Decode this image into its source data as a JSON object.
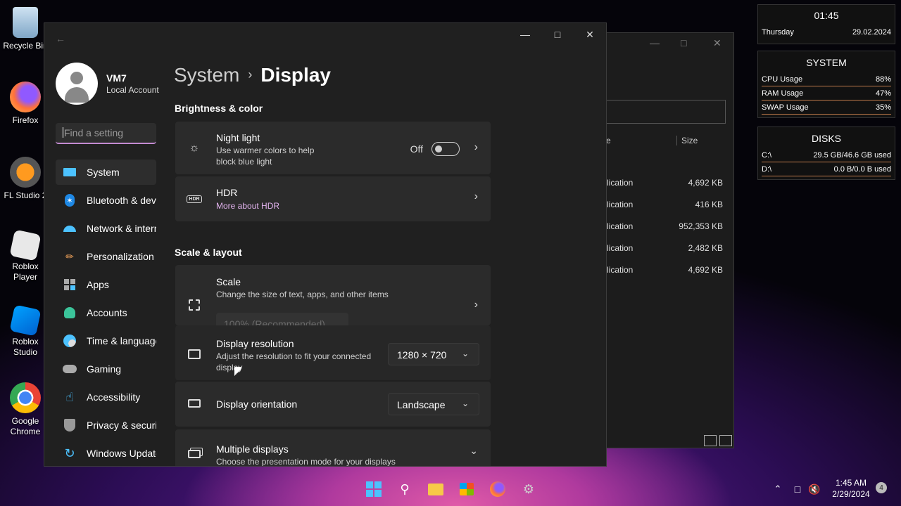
{
  "desktop": {
    "icons": [
      {
        "label": "Recycle Bin",
        "icon": "recycle-bin-icon"
      },
      {
        "label": "Firefox",
        "icon": "firefox-icon"
      },
      {
        "label": "FL Studio 2",
        "icon": "fl-studio-icon"
      },
      {
        "label": "Roblox Player",
        "icon": "roblox-player-icon"
      },
      {
        "label": "Roblox Studio",
        "icon": "roblox-studio-icon"
      },
      {
        "label": "Google Chrome",
        "icon": "chrome-icon"
      }
    ]
  },
  "explorer_bg": {
    "column_size": "Size",
    "column_type_fragment": "e",
    "rows": [
      {
        "type": "lication",
        "size": "4,692 KB"
      },
      {
        "type": "lication",
        "size": "416 KB"
      },
      {
        "type": "lication",
        "size": "952,353 KB"
      },
      {
        "type": "lication",
        "size": "2,482 KB"
      },
      {
        "type": "lication",
        "size": "4,692 KB"
      }
    ]
  },
  "settings": {
    "user": {
      "name": "VM7",
      "type": "Local Account"
    },
    "search_placeholder": "Find a setting",
    "nav": [
      {
        "label": "System",
        "icon": "system-icon",
        "active": true
      },
      {
        "label": "Bluetooth & devices",
        "icon": "bluetooth-icon"
      },
      {
        "label": "Network & internet",
        "icon": "wifi-icon"
      },
      {
        "label": "Personalization",
        "icon": "brush-icon"
      },
      {
        "label": "Apps",
        "icon": "apps-icon"
      },
      {
        "label": "Accounts",
        "icon": "account-icon"
      },
      {
        "label": "Time & language",
        "icon": "globe-clock-icon"
      },
      {
        "label": "Gaming",
        "icon": "gamepad-icon"
      },
      {
        "label": "Accessibility",
        "icon": "accessibility-icon"
      },
      {
        "label": "Privacy & security",
        "icon": "shield-icon"
      },
      {
        "label": "Windows Update",
        "icon": "update-icon"
      }
    ],
    "breadcrumb": {
      "parent": "System",
      "separator": "›",
      "current": "Display"
    },
    "sections": {
      "brightness": "Brightness & color",
      "scale_layout": "Scale & layout"
    },
    "night_light": {
      "title": "Night light",
      "subtitle": "Use warmer colors to help block blue light",
      "state": "Off",
      "icon": "brightness-icon"
    },
    "hdr": {
      "title": "HDR",
      "subtitle": "More about HDR",
      "icon": "hdr-icon"
    },
    "scale": {
      "title": "Scale",
      "subtitle": "Change the size of text, apps, and other items",
      "value": "100% (Recommended)",
      "icon": "scale-icon"
    },
    "resolution": {
      "title": "Display resolution",
      "subtitle": "Adjust the resolution to fit your connected display",
      "value": "1280 × 720",
      "icon": "resolution-icon"
    },
    "orientation": {
      "title": "Display orientation",
      "value": "Landscape",
      "icon": "orientation-icon"
    },
    "multiple": {
      "title": "Multiple displays",
      "subtitle": "Choose the presentation mode for your displays",
      "icon": "multiple-displays-icon"
    }
  },
  "widgets": {
    "clock": {
      "time": "01:45",
      "day": "Thursday",
      "date": "29.02.2024"
    },
    "system": {
      "title": "SYSTEM",
      "stats": [
        {
          "label": "CPU Usage",
          "value": "88%"
        },
        {
          "label": "RAM Usage",
          "value": "47%"
        },
        {
          "label": "SWAP Usage",
          "value": "35%"
        }
      ]
    },
    "disks": {
      "title": "DISKS",
      "stats": [
        {
          "label": "C:\\",
          "value": "29.5 GB/46.6 GB used"
        },
        {
          "label": "D:\\",
          "value": "0.0 B/0.0 B used"
        }
      ]
    }
  },
  "taskbar": {
    "time": "1:45 AM",
    "date": "2/29/2024",
    "notifications": "4"
  }
}
